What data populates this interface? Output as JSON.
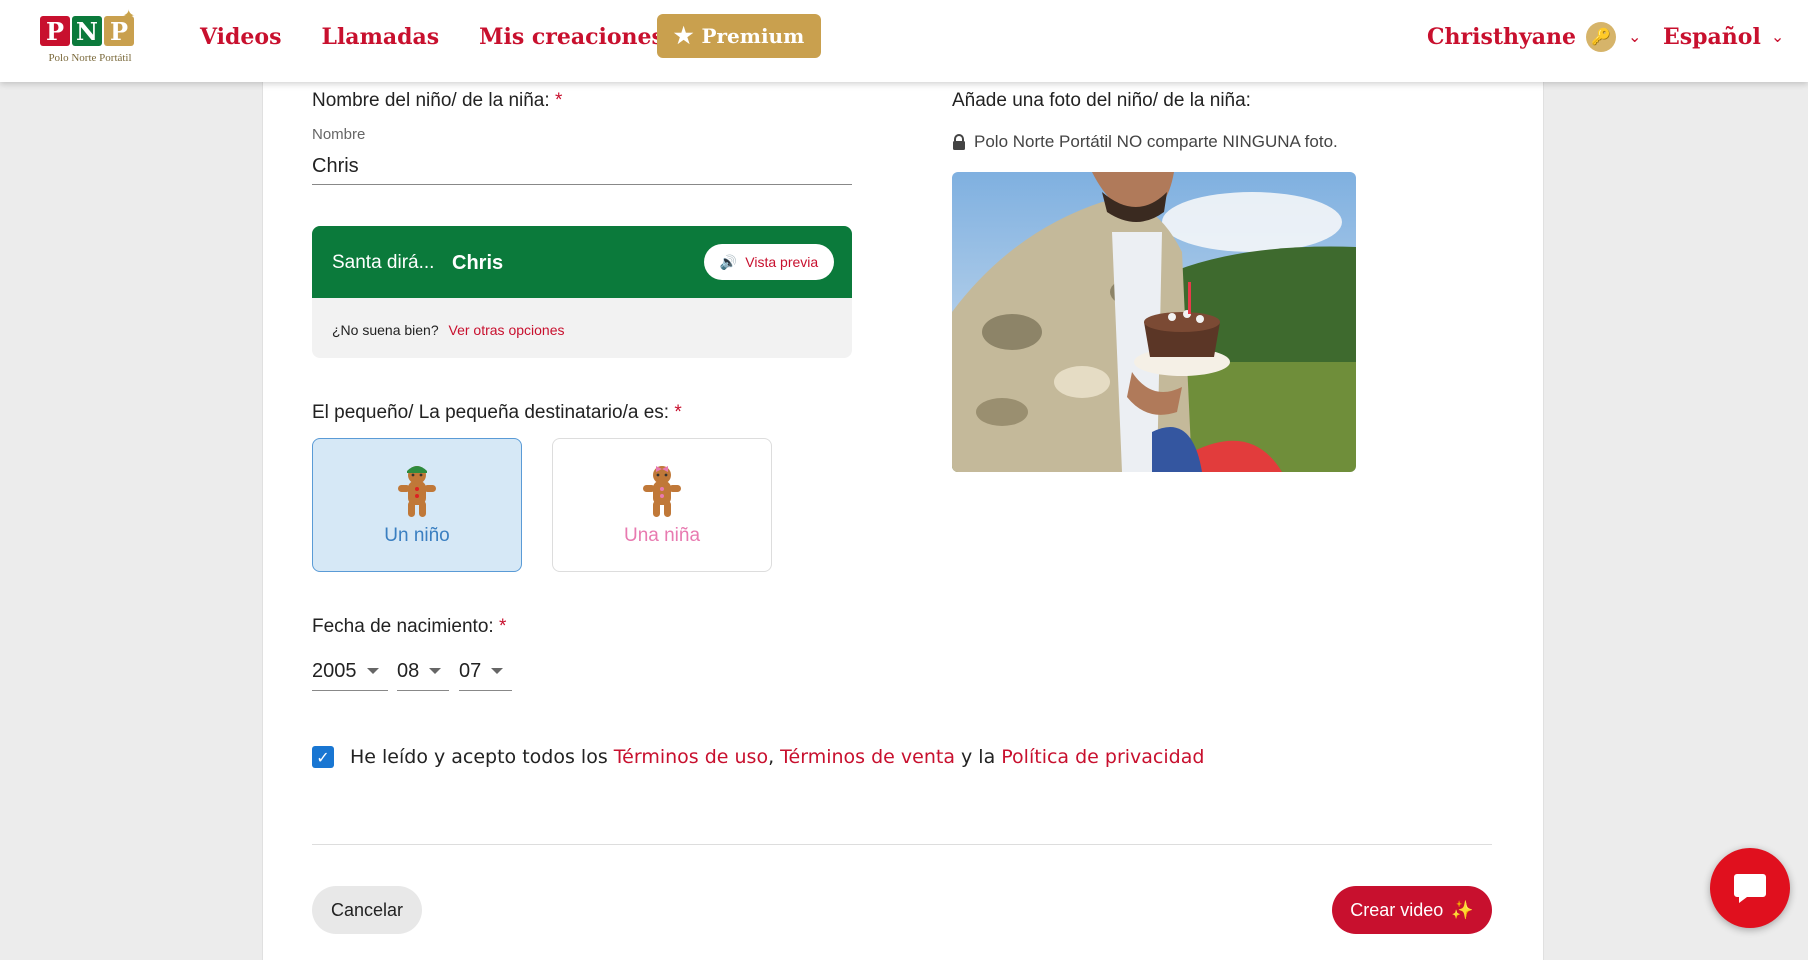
{
  "header": {
    "logo_letters": [
      "P",
      "N",
      "P"
    ],
    "logo_subtitle": "Polo Norte Portátil",
    "nav": [
      "Videos",
      "Llamadas",
      "Mis creaciones"
    ],
    "premium_label": "Premium",
    "user_name": "Christhyane",
    "language": "Español"
  },
  "form": {
    "name_label": "Nombre del niño/ de la niña:",
    "required_mark": "*",
    "name_field_label": "Nombre",
    "name_value": "Chris",
    "santa_says": "Santa dirá...",
    "santa_name": "Chris",
    "preview_label": "Vista previa",
    "not_right_text": "¿No suena bien?",
    "other_options_link": "Ver otras opciones",
    "recipient_label": "El pequeño/ La pequeña destinatario/a es:",
    "boy_label": "Un niño",
    "girl_label": "Una niña",
    "birth_label": "Fecha de nacimiento:",
    "birth_year": "2005",
    "birth_month": "08",
    "birth_day": "07",
    "terms_prefix": "He leído y acepto todos los",
    "terms_use": "Términos de uso",
    "terms_comma": ",",
    "terms_sale": "Términos de venta",
    "terms_and": "y la",
    "privacy": "Política de privacidad",
    "cancel": "Cancelar",
    "create": "Crear video"
  },
  "photo": {
    "label": "Añade una foto del niño/ de la niña:",
    "note": "Polo Norte Portátil NO comparte NINGUNA foto."
  },
  "colors": {
    "brand_red": "#c8102e",
    "gold": "#c9a04e",
    "santa_green": "#0b7a3b",
    "boy_blue": "#5a9bd6",
    "girl_pink": "#e87ab0"
  }
}
